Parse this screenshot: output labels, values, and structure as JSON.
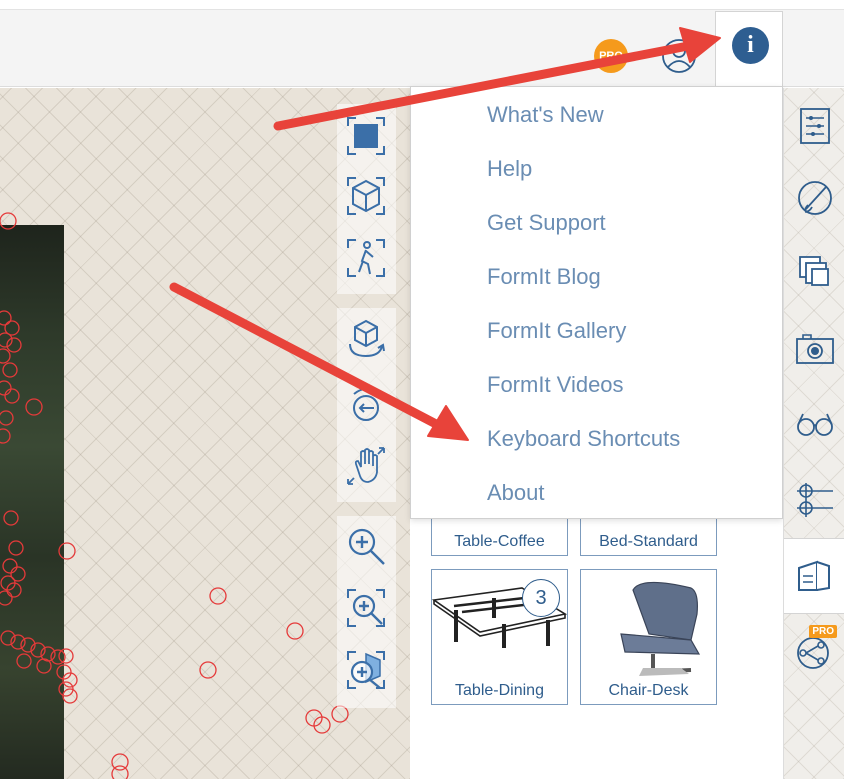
{
  "header": {
    "pro_badge": "PRO",
    "info_icon_glyph": "i"
  },
  "info_menu": {
    "items": [
      {
        "label": "What's New"
      },
      {
        "label": "Help"
      },
      {
        "label": "Get Support"
      },
      {
        "label": "FormIt Blog"
      },
      {
        "label": "FormIt Gallery"
      },
      {
        "label": "FormIt Videos"
      },
      {
        "label": "Keyboard Shortcuts"
      },
      {
        "label": "About"
      }
    ]
  },
  "content_library": {
    "tiles": [
      {
        "label": "Table-Coffee"
      },
      {
        "label": "Bed-Standard"
      },
      {
        "label": "Table-Dining",
        "badge": "3"
      },
      {
        "label": "Chair-Desk"
      }
    ]
  },
  "right_panel": {
    "pro_badge": "PRO"
  },
  "colors": {
    "accent_blue": "#2f5d8c",
    "menu_text": "#6a8db3",
    "pro_orange": "#f59a1c",
    "annotation_red": "#e8433a"
  },
  "icons": {
    "toolbar": [
      "pro-badge-icon",
      "user-icon",
      "info-icon"
    ],
    "nav": [
      "view-shaded-icon",
      "view-3d-icon",
      "walkthrough-icon",
      "orbit-icon",
      "look-around-icon",
      "pan-icon",
      "zoom-icon",
      "zoom-extents-icon",
      "zoom-selected-icon"
    ],
    "right_panel": [
      "properties-icon",
      "materials-icon",
      "layers-icon",
      "scenes-icon",
      "visibility-icon",
      "levels-icon",
      "content-library-icon",
      "dynamo-icon"
    ]
  }
}
